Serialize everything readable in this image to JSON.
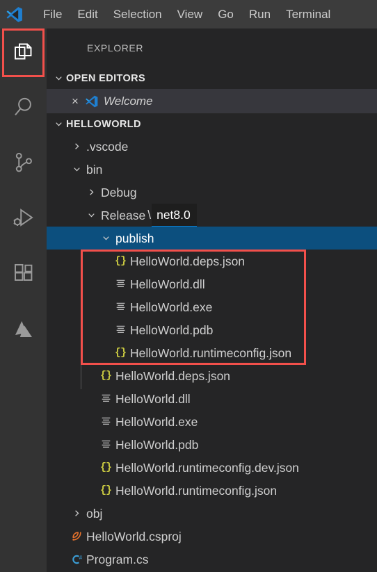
{
  "window": {
    "app_logo": "vscode-logo",
    "menu_items": [
      "File",
      "Edit",
      "Selection",
      "View",
      "Go",
      "Run",
      "Terminal"
    ]
  },
  "colors": {
    "titlebar_bg": "#3c3c3c",
    "activitybar_bg": "#333333",
    "sidebar_bg": "#252526",
    "selection_blue": "#0c4f7e",
    "annotation_red": "#f2504b",
    "json_icon_yellow": "#cbcb41",
    "csproj_icon_orange": "#e8732c",
    "csharp_icon_blue": "#3b9fd8",
    "focus_underline_blue": "#0a84d8",
    "text": "#cfcfcf"
  },
  "activity_bar": {
    "items": [
      {
        "name": "explorer",
        "icon": "files-icon",
        "active": true,
        "highlighted": true
      },
      {
        "name": "search",
        "icon": "search-icon",
        "active": false,
        "highlighted": false
      },
      {
        "name": "source-control",
        "icon": "source-control-icon",
        "active": false,
        "highlighted": false
      },
      {
        "name": "run-and-debug",
        "icon": "run-and-debug-icon",
        "active": false,
        "highlighted": false
      },
      {
        "name": "extensions",
        "icon": "extensions-icon",
        "active": false,
        "highlighted": false
      },
      {
        "name": "azure",
        "icon": "azure-icon",
        "active": false,
        "highlighted": false
      }
    ]
  },
  "sidebar": {
    "title": "EXPLORER",
    "open_editors": {
      "header": "OPEN EDITORS",
      "expanded": true,
      "items": [
        {
          "label": "Welcome",
          "icon": "vscode-logo-icon",
          "close_glyph": "×",
          "italic": true
        }
      ]
    },
    "workspace": {
      "header": "HELLOWORLD",
      "expanded": true
    },
    "tree": [
      {
        "id": "vscode",
        "label": ".vscode",
        "type": "folder",
        "depth": 1,
        "expanded": false,
        "icon": "chevron-right-icon"
      },
      {
        "id": "bin",
        "label": "bin",
        "type": "folder",
        "depth": 1,
        "expanded": true,
        "icon": "chevron-down-icon"
      },
      {
        "id": "debug",
        "label": "Debug",
        "type": "folder",
        "depth": 2,
        "expanded": false,
        "icon": "chevron-right-icon"
      },
      {
        "id": "release",
        "label": "Release",
        "type": "folder-compact",
        "depth": 2,
        "expanded": true,
        "icon": "chevron-down-icon",
        "separator": "\\",
        "segment": "net8.0",
        "segment_focused": true
      },
      {
        "id": "publish",
        "label": "publish",
        "type": "folder",
        "depth": 3,
        "expanded": true,
        "icon": "chevron-down-icon",
        "selected": true
      },
      {
        "id": "pub-deps",
        "label": "HelloWorld.deps.json",
        "type": "file",
        "depth": 4,
        "icon": "json-icon",
        "boxed": true
      },
      {
        "id": "pub-dll",
        "label": "HelloWorld.dll",
        "type": "file",
        "depth": 4,
        "icon": "binary-icon",
        "boxed": true
      },
      {
        "id": "pub-exe",
        "label": "HelloWorld.exe",
        "type": "file",
        "depth": 4,
        "icon": "binary-icon",
        "boxed": true
      },
      {
        "id": "pub-pdb",
        "label": "HelloWorld.pdb",
        "type": "file",
        "depth": 4,
        "icon": "binary-icon",
        "boxed": true
      },
      {
        "id": "pub-rtcfg",
        "label": "HelloWorld.runtimeconfig.json",
        "type": "file",
        "depth": 4,
        "icon": "json-icon",
        "boxed": true
      },
      {
        "id": "rel-deps",
        "label": "HelloWorld.deps.json",
        "type": "file",
        "depth": 3,
        "icon": "json-icon"
      },
      {
        "id": "rel-dll",
        "label": "HelloWorld.dll",
        "type": "file",
        "depth": 3,
        "icon": "binary-icon"
      },
      {
        "id": "rel-exe",
        "label": "HelloWorld.exe",
        "type": "file",
        "depth": 3,
        "icon": "binary-icon"
      },
      {
        "id": "rel-pdb",
        "label": "HelloWorld.pdb",
        "type": "file",
        "depth": 3,
        "icon": "binary-icon"
      },
      {
        "id": "rel-rtcfg-dev",
        "label": "HelloWorld.runtimeconfig.dev.json",
        "type": "file",
        "depth": 3,
        "icon": "json-icon"
      },
      {
        "id": "rel-rtcfg",
        "label": "HelloWorld.runtimeconfig.json",
        "type": "file",
        "depth": 3,
        "icon": "json-icon"
      },
      {
        "id": "obj",
        "label": "obj",
        "type": "folder",
        "depth": 1,
        "expanded": false,
        "icon": "chevron-right-icon"
      },
      {
        "id": "csproj",
        "label": "HelloWorld.csproj",
        "type": "file",
        "depth": 1,
        "icon": "csproj-icon"
      },
      {
        "id": "programcs",
        "label": "Program.cs",
        "type": "file",
        "depth": 1,
        "icon": "csharp-icon"
      }
    ]
  },
  "annotations": [
    {
      "name": "explorer-icon-highlight",
      "target": "activity-bar-explorer"
    },
    {
      "name": "publish-files-highlight",
      "target": "publish-folder-contents"
    }
  ]
}
